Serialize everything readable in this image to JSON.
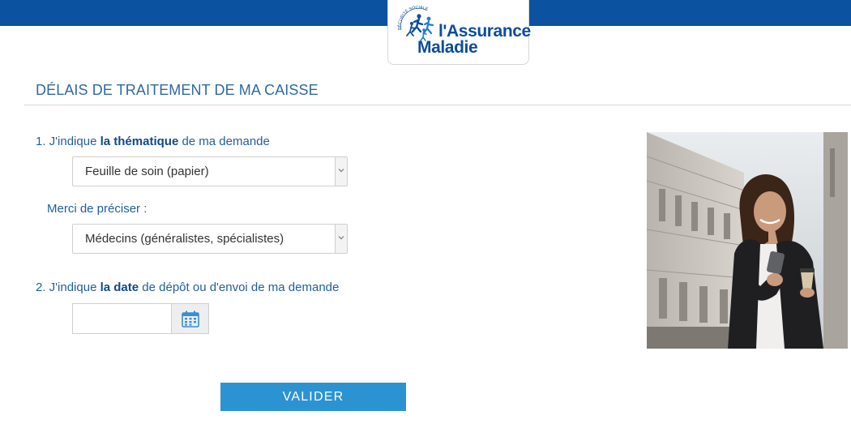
{
  "header": {
    "brand_line1": "l'Assurance",
    "brand_line2": "Maladie",
    "seal_text": "SÉCURITÉ SOCIALE",
    "bar_color": "#0b52a0"
  },
  "page": {
    "title": "DÉLAIS DE TRAITEMENT DE MA CAISSE"
  },
  "form": {
    "q1": {
      "prefix": "1. J'indique ",
      "bold": "la thématique",
      "suffix": " de ma demande",
      "selected": "Feuille de soin (papier)"
    },
    "q1b": {
      "label": "Merci de préciser :",
      "selected": "Médecins (généralistes, spécialistes)"
    },
    "q2": {
      "prefix": "2. J'indique ",
      "bold": "la date",
      "suffix": " de dépôt ou d'envoi de ma demande",
      "value": "",
      "icon": "calendar-icon"
    },
    "submit_label": "VALIDER",
    "submit_color": "#2c93d3"
  },
  "illustration": {
    "icon": "photo-woman-with-phone"
  }
}
